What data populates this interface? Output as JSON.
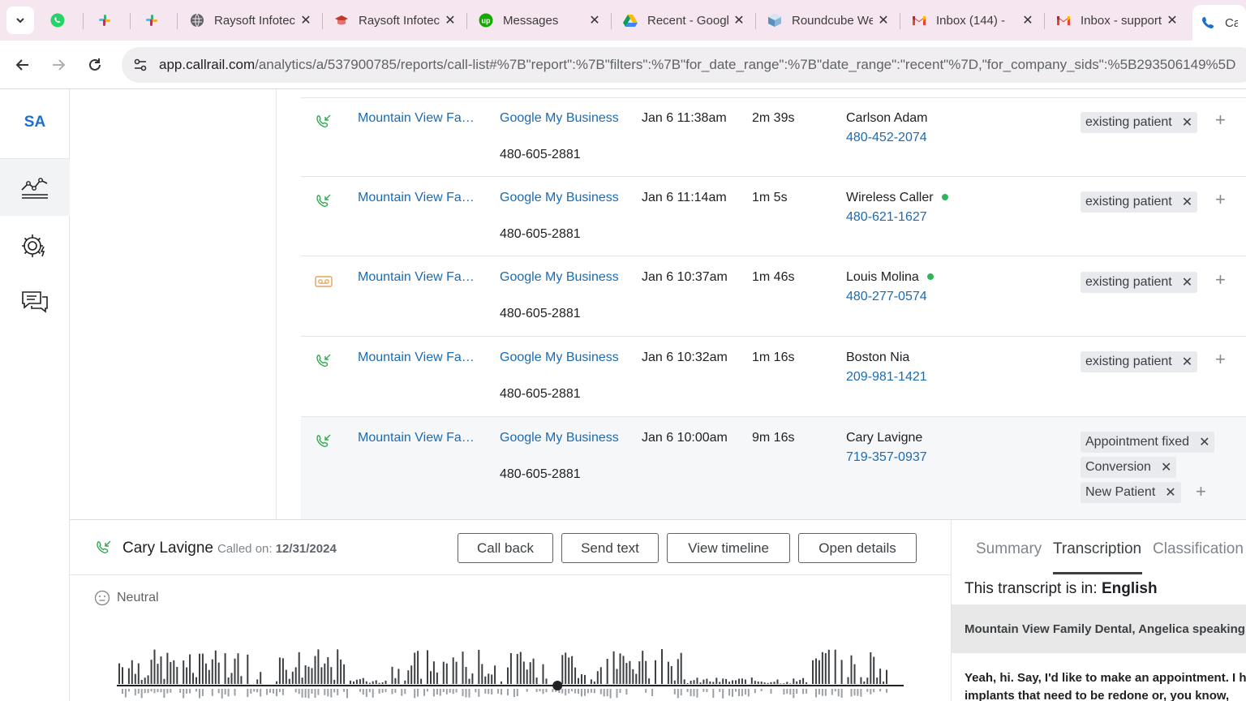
{
  "browser": {
    "tabs": [
      {
        "label": "",
        "icon": "whatsapp-icon"
      },
      {
        "label": "",
        "icon": "slack-icon"
      },
      {
        "label": "",
        "icon": "slack-icon"
      },
      {
        "label": "Raysoft Infotech",
        "icon": "globe-icon"
      },
      {
        "label": "Raysoft Infotech",
        "icon": "graduation-cap-icon"
      },
      {
        "label": "Messages",
        "icon": "upwork-icon"
      },
      {
        "label": "Recent - Google Drive",
        "icon": "google-drive-icon"
      },
      {
        "label": "Roundcube Webmail",
        "icon": "roundcube-icon"
      },
      {
        "label": "Inbox (144) - ",
        "icon": "gmail-icon"
      },
      {
        "label": "Inbox - support",
        "icon": "gmail-icon"
      },
      {
        "label": "Call",
        "icon": "callrail-icon"
      }
    ],
    "url_host": "app.callrail.com",
    "url_path": "/analytics/a/537900785/reports/call-list#%7B\"report\":%7B\"filters\":%7B\"for_date_range\":%7B\"date_range\":\"recent\"%7D,\"for_company_sids\":%5B293506149%5D"
  },
  "app": {
    "logo": "SA",
    "accent": "#1b6fd1",
    "nav": [
      {
        "name": "analytics",
        "icon": "analytics-icon"
      },
      {
        "name": "settings",
        "icon": "gear-icon"
      },
      {
        "name": "conversations",
        "icon": "chat-icon"
      }
    ]
  },
  "calls": [
    {
      "type": "inbound",
      "company": "Mountain View Family Dental",
      "source": "Google My Business",
      "tracking": "480-605-2881",
      "datetime": "Jan 6 11:38am",
      "duration": "2m 39s",
      "caller": "Carlson Adam",
      "caller_dot": false,
      "phone": "480-452-2074",
      "tags": [
        "existing patient"
      ]
    },
    {
      "type": "inbound",
      "company": "Mountain View Family Dental",
      "source": "Google My Business",
      "tracking": "480-605-2881",
      "datetime": "Jan 6 11:14am",
      "duration": "1m 5s",
      "caller": "Wireless Caller",
      "caller_dot": true,
      "phone": "480-621-1627",
      "tags": [
        "existing patient"
      ]
    },
    {
      "type": "voicemail",
      "company": "Mountain View Family Dental",
      "source": "Google My Business",
      "tracking": "480-605-2881",
      "datetime": "Jan 6 10:37am",
      "duration": "1m 46s",
      "caller": "Louis Molina",
      "caller_dot": true,
      "phone": "480-277-0574",
      "tags": [
        "existing patient"
      ]
    },
    {
      "type": "inbound",
      "company": "Mountain View Family Dental",
      "source": "Google My Business",
      "tracking": "480-605-2881",
      "datetime": "Jan 6 10:32am",
      "duration": "1m 16s",
      "caller": "Boston Nia",
      "caller_dot": false,
      "phone": "209-981-1421",
      "tags": [
        "existing patient"
      ]
    },
    {
      "type": "inbound",
      "company": "Mountain View Family Dental",
      "source": "Google My Business",
      "tracking": "480-605-2881",
      "datetime": "Jan 6 10:00am",
      "duration": "9m 16s",
      "caller": "Cary Lavigne",
      "caller_dot": false,
      "phone": "719-357-0937",
      "tags": [
        "Appointment fixed",
        "Conversion",
        "New Patient"
      ]
    }
  ],
  "detail": {
    "caller_name": "Cary Lavigne",
    "called_on_label": "Called on:",
    "called_on_date": "12/31/2024",
    "buttons": {
      "call_back": "Call back",
      "send_text": "Send text",
      "view_timeline": "View timeline",
      "open_details": "Open details"
    },
    "sentiment": "Neutral",
    "playback_progress": 0.56
  },
  "panel": {
    "tabs": [
      "Summary",
      "Transcription",
      "Classification"
    ],
    "active_tab": "Transcription",
    "language_label": "This transcript is in:",
    "language": "English",
    "speaker": "Mountain View Family Dental, Angelica speaking",
    "transcript_line1": "Yeah, hi. Say, I'd like to make an appointment. I have",
    "transcript_line2": "implants that need to be redone or, you know,"
  }
}
